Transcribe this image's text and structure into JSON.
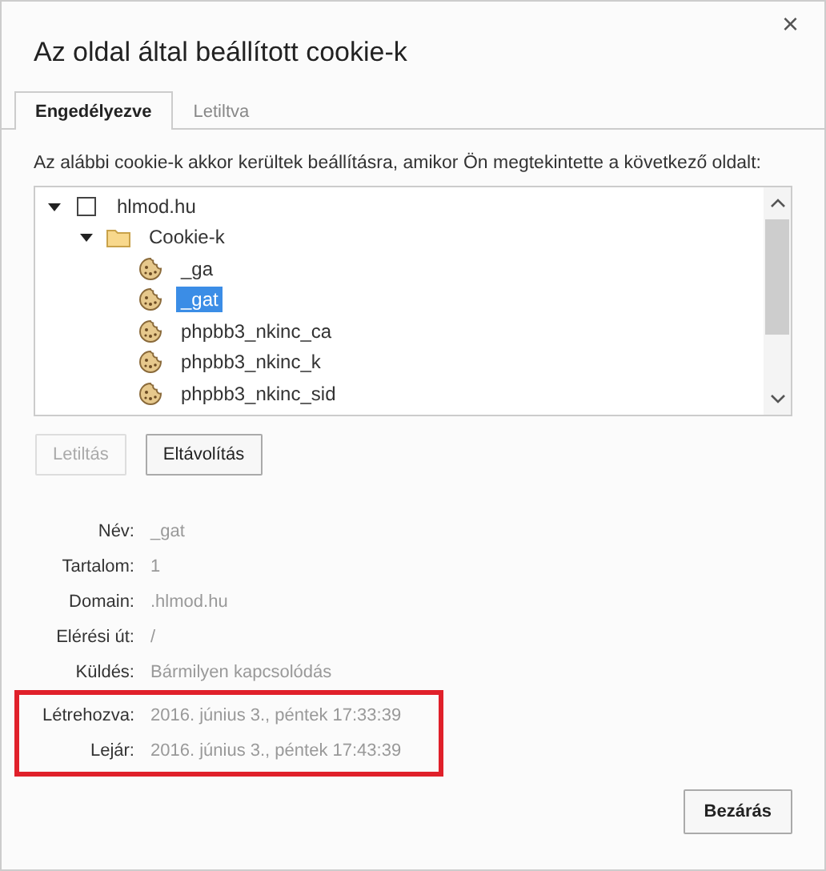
{
  "dialog": {
    "title": "Az oldal által beállított cookie-k",
    "close": "×"
  },
  "tabs": [
    {
      "label": "Engedélyezve",
      "selected": true
    },
    {
      "label": "Letiltva",
      "selected": false
    }
  ],
  "description": "Az alábbi cookie-k akkor kerültek beállításra, amikor Ön megtekintette a következő oldalt:",
  "tree": [
    {
      "label": "hlmod.hu",
      "kind": "site",
      "expanded": true,
      "selected": false,
      "children": [
        {
          "label": "Cookie-k",
          "kind": "folder",
          "expanded": true,
          "selected": false,
          "children": [
            {
              "label": "_ga",
              "kind": "cookie",
              "selected": false
            },
            {
              "label": "_gat",
              "kind": "cookie",
              "selected": true
            },
            {
              "label": "phpbb3_nkinc_ca",
              "kind": "cookie",
              "selected": false
            },
            {
              "label": "phpbb3_nkinc_k",
              "kind": "cookie",
              "selected": false
            },
            {
              "label": "phpbb3_nkinc_sid",
              "kind": "cookie",
              "selected": false
            }
          ]
        }
      ]
    }
  ],
  "actions": [
    {
      "label": "Letiltás",
      "disabled": true
    },
    {
      "label": "Eltávolítás",
      "disabled": false
    }
  ],
  "details": [
    {
      "label": "Név:",
      "value": "_gat",
      "highlighted": false
    },
    {
      "label": "Tartalom:",
      "value": "1",
      "highlighted": false
    },
    {
      "label": "Domain:",
      "value": ".hlmod.hu",
      "highlighted": false
    },
    {
      "label": "Elérési út:",
      "value": "/",
      "highlighted": false
    },
    {
      "label": "Küldés:",
      "value": "Bármilyen kapcsolódás",
      "highlighted": false
    },
    {
      "label": "Létrehozva:",
      "value": "2016. június 3., péntek 17:33:39",
      "highlighted": true
    },
    {
      "label": "Lejár:",
      "value": "2016. június 3., péntek 17:43:39",
      "highlighted": true
    }
  ],
  "close_button": "Bezárás"
}
